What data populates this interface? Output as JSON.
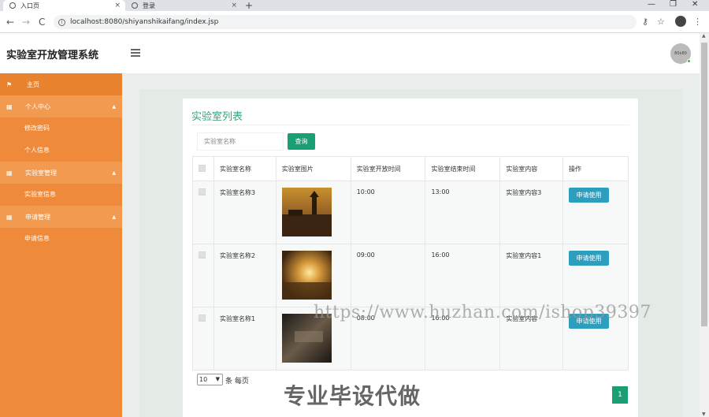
{
  "browser": {
    "tabs": [
      {
        "label": "入口页",
        "close": "×"
      },
      {
        "label": "登录",
        "close": "×"
      }
    ],
    "new_tab": "+",
    "window_controls": [
      "—",
      "❐",
      "✕"
    ],
    "url": "localhost:8080/shiyanshikaifang/index.jsp",
    "nav": {
      "back": "←",
      "forward": "→",
      "reload": "C"
    },
    "right_icons": {
      "key": "⚷",
      "star": "☆",
      "menu": "⋮"
    }
  },
  "header": {
    "title": "实验室开放管理系统",
    "avatar_text": "80x80"
  },
  "sidebar": {
    "home": {
      "icon": "flag-icon",
      "label": "主页"
    },
    "groups": [
      {
        "icon": "grid-icon",
        "label": "个人中心",
        "arrow": "▲",
        "items": [
          "修改密码",
          "个人信息"
        ]
      },
      {
        "icon": "grid-icon",
        "label": "实验室管理",
        "arrow": "▲",
        "items": [
          "实验室信息"
        ]
      },
      {
        "icon": "grid-icon",
        "label": "申请管理",
        "arrow": "▲",
        "items": [
          "申请信息"
        ]
      }
    ]
  },
  "main": {
    "card_title": "实验室列表",
    "search": {
      "placeholder": "实验室名称",
      "button": "查询"
    },
    "table": {
      "headers": [
        "",
        "实验室名称",
        "实验室图片",
        "实验室开放时间",
        "实验室结束时间",
        "实验室内容",
        "操作"
      ],
      "rows": [
        {
          "name": "实验室名称3",
          "open": "10:00",
          "close": "13:00",
          "content": "实验室内容3",
          "action": "申请使用"
        },
        {
          "name": "实验室名称2",
          "open": "09:00",
          "close": "16:00",
          "content": "实验室内容1",
          "action": "申请使用"
        },
        {
          "name": "实验室名称1",
          "open": "08:00",
          "close": "16:00",
          "content": "实验室内容",
          "action": "申请使用"
        }
      ]
    },
    "pager": {
      "size": "10",
      "size_suffix": "条 每页",
      "current_page": "1"
    }
  },
  "watermarks": {
    "url": "https://www.huzhan.com/ishop39397",
    "slogan": "专业毕设代做"
  },
  "colors": {
    "sidebar": "#ee8a39",
    "accent_green": "#1a9e74",
    "title_green": "#3ba37a",
    "apply_blue": "#2c9fc1"
  }
}
